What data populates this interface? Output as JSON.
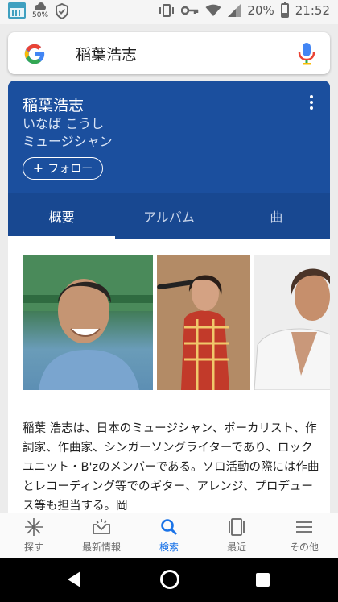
{
  "status_bar": {
    "weather_percent": "50%",
    "battery": "20%",
    "time": "21:52"
  },
  "search": {
    "query": "稲葉浩志"
  },
  "entity": {
    "name": "稲葉浩志",
    "reading": "いなば こうし",
    "role": "ミュージシャン",
    "follow_label": "フォロー"
  },
  "tabs": [
    {
      "label": "概要",
      "active": true
    },
    {
      "label": "アルバム",
      "active": false
    },
    {
      "label": "曲",
      "active": false
    }
  ],
  "description": "稲葉 浩志は、日本のミュージシャン、ボーカリスト、作詞家、作曲家、シンガーソングライターであり、ロックユニット・B'zのメンバーである。ソロ活動の際には作曲とレコーディング等でのギター、アレンジ、プロデュース等も担当する。岡",
  "bottom_nav": [
    {
      "label": "探す",
      "icon": "asterisk-icon"
    },
    {
      "label": "最新情報",
      "icon": "updates-icon"
    },
    {
      "label": "検索",
      "icon": "search-icon",
      "active": true
    },
    {
      "label": "最近",
      "icon": "recent-cards-icon"
    },
    {
      "label": "その他",
      "icon": "menu-icon"
    }
  ],
  "colors": {
    "card_blue": "#1b4f9e",
    "tab_blue": "#184891",
    "accent": "#1a73e8"
  }
}
